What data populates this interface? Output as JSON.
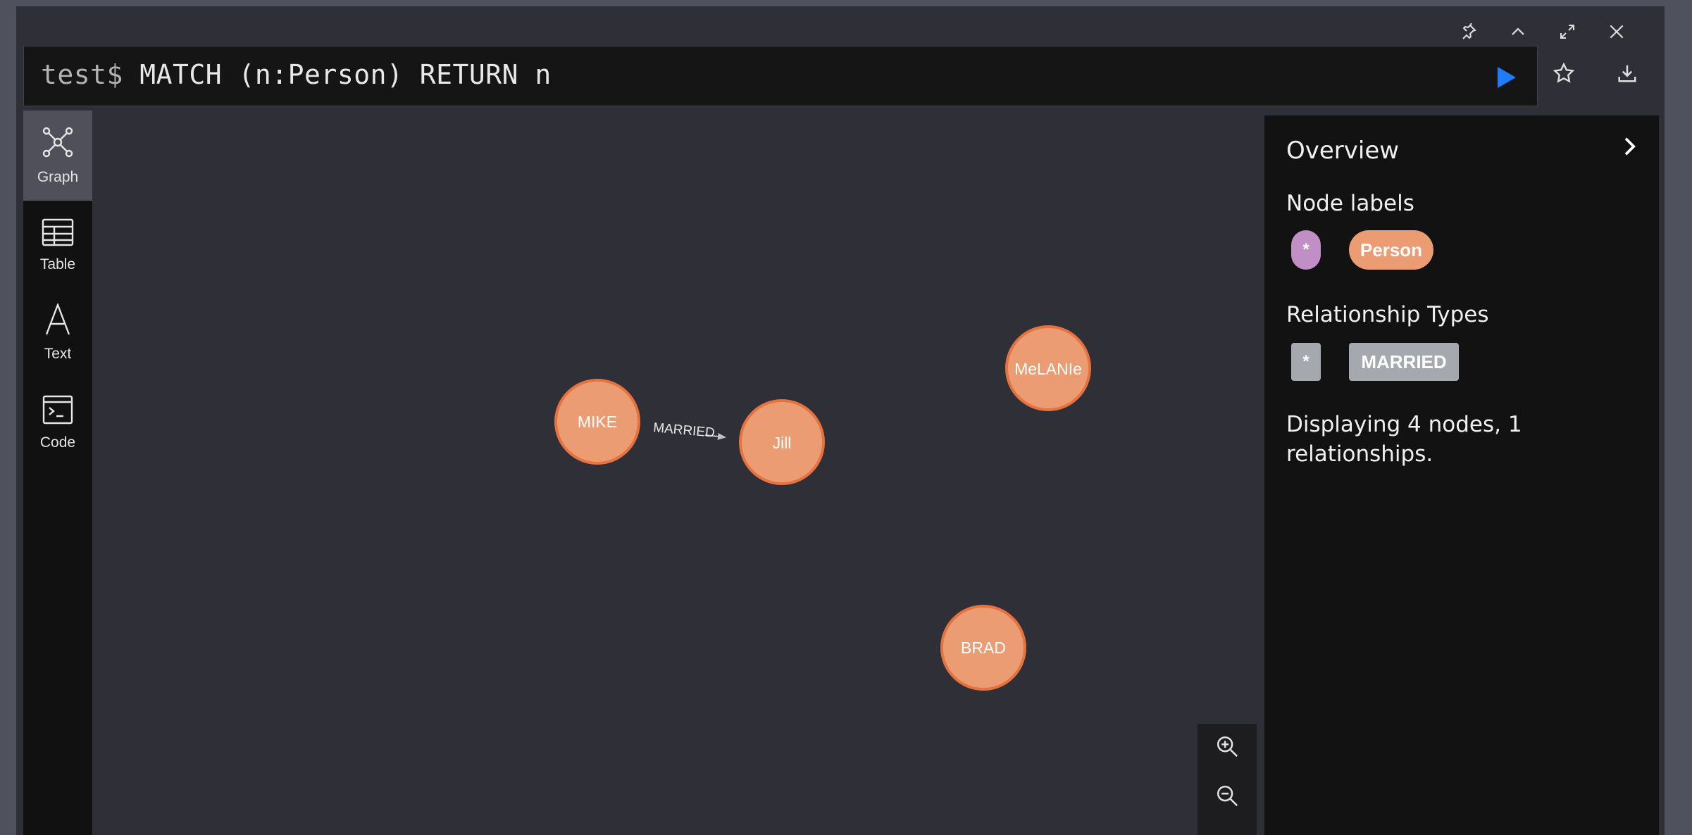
{
  "editor": {
    "prompt": "test$",
    "query": "MATCH (n:Person) RETURN n"
  },
  "window_controls": {
    "icons": [
      "pin-icon",
      "chevron-up-icon",
      "expand-icon",
      "close-icon"
    ]
  },
  "actions": {
    "icons": [
      "play-icon",
      "star-icon",
      "download-icon"
    ],
    "run_color": "#1f7cff"
  },
  "sidebar": {
    "items": [
      {
        "label": "Graph",
        "icon": "graph-icon",
        "active": true
      },
      {
        "label": "Table",
        "icon": "table-icon",
        "active": false
      },
      {
        "label": "Text",
        "icon": "text-icon",
        "active": false
      },
      {
        "label": "Code",
        "icon": "code-icon",
        "active": false
      }
    ]
  },
  "graph": {
    "node_color": "#ec9c72",
    "node_border": "#e6733f",
    "nodes": [
      {
        "label": "MIKE"
      },
      {
        "label": "Jill"
      },
      {
        "label": "MeLANIe"
      },
      {
        "label": "BRAD"
      }
    ],
    "relationships": [
      {
        "from": "MIKE",
        "to": "Jill",
        "type": "MARRIED"
      }
    ]
  },
  "zoom": {
    "icons": [
      "zoom-in-icon",
      "zoom-out-icon"
    ]
  },
  "overview": {
    "title": "Overview",
    "node_labels_heading": "Node labels",
    "node_labels": [
      {
        "label": "*",
        "color": "#c28ec6"
      },
      {
        "label": "Person",
        "color": "#ec9c72"
      }
    ],
    "relationship_types_heading": "Relationship Types",
    "relationship_types": [
      {
        "label": "*",
        "color": "#a6a8b0"
      },
      {
        "label": "MARRIED",
        "color": "#a6a8b0"
      }
    ],
    "summary": "Displaying 4 nodes, 1 relationships."
  }
}
